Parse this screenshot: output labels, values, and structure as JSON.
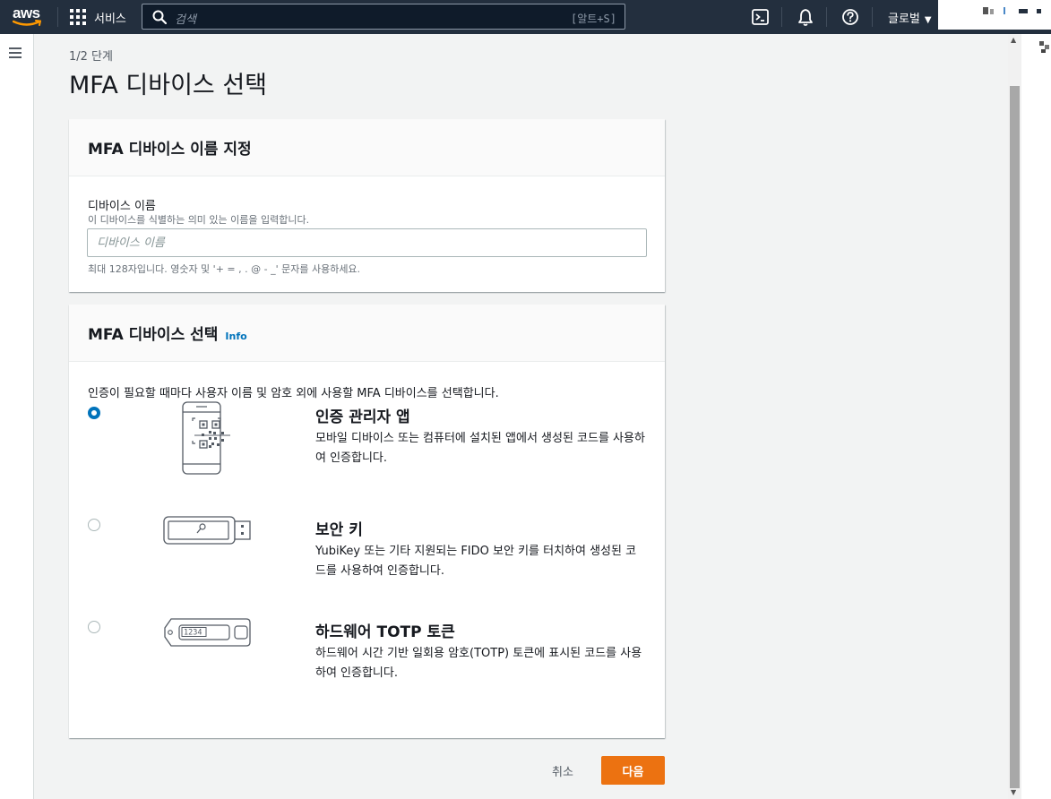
{
  "topnav": {
    "logo_text": "aws",
    "services_label": "서비스",
    "search_placeholder": "검색",
    "search_shortcut": "[알트+S]",
    "region_label": "글로벌",
    "icons": [
      "cloudshell-icon",
      "bell-icon",
      "help-icon"
    ]
  },
  "main": {
    "step_label": "1/2 단계",
    "page_title": "MFA 디바이스 선택"
  },
  "name_card": {
    "title": "MFA 디바이스 이름 지정",
    "field_label": "디바이스 이름",
    "field_description": "이 디바이스를 식별하는 의미 있는 이름을 입력합니다.",
    "field_placeholder": "디바이스 이름",
    "field_value": "",
    "field_hint": "최대 128자입니다. 영숫자 및 '+ = , . @ - _' 문자를 사용하세요."
  },
  "select_card": {
    "title": "MFA 디바이스 선택",
    "info_label": "Info",
    "description": "인증이 필요할 때마다 사용자 이름 및 암호 외에 사용할 MFA 디바이스를 선택합니다.",
    "options": [
      {
        "title": "인증 관리자 앱",
        "description": "모바일 디바이스 또는 컴퓨터에 설치된 앱에서 생성된 코드를 사용하여 인증합니다.",
        "selected": true
      },
      {
        "title": "보안 키",
        "description": "YubiKey 또는 기타 지원되는 FIDO 보안 키를 터치하여 생성된 코드를 사용하여 인증합니다.",
        "selected": false
      },
      {
        "title": "하드웨어 TOTP 토큰",
        "description": "하드웨어 시간 기반 일회용 암호(TOTP) 토큰에 표시된 코드를 사용하여 인증합니다.",
        "selected": false
      }
    ],
    "totp_display_digits": "1234"
  },
  "actions": {
    "cancel_label": "취소",
    "next_label": "다음"
  },
  "colors": {
    "nav_bg": "#232f3e",
    "primary_button": "#ec7211",
    "selected_radio": "#0073bb",
    "info_link": "#0073bb"
  }
}
